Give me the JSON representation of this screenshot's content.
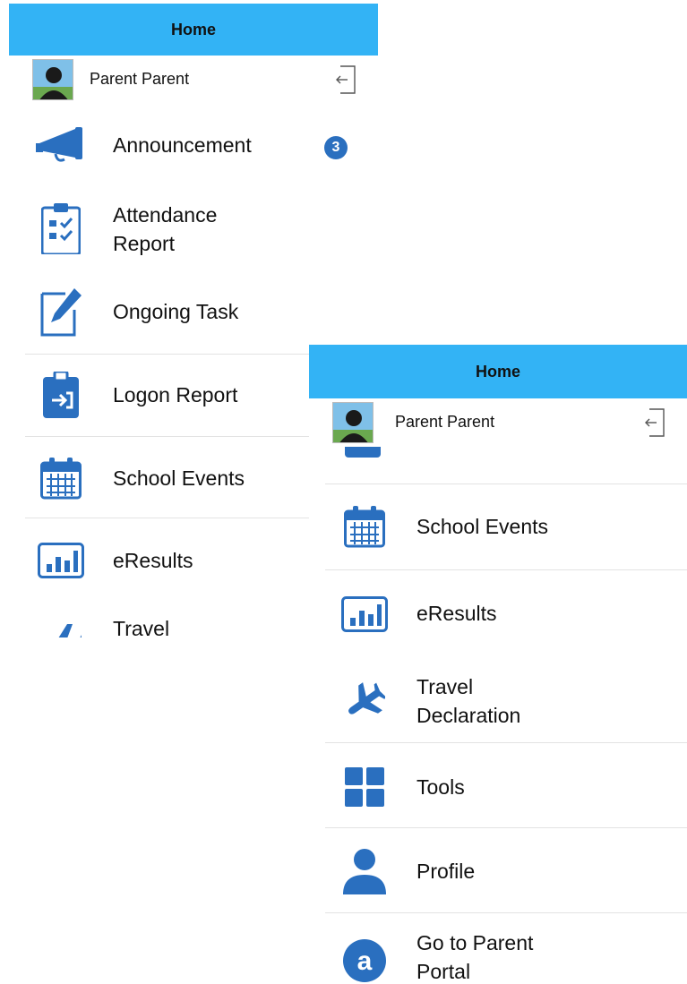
{
  "screen1": {
    "title": "Home",
    "user_name": "Parent  Parent",
    "menu": [
      {
        "label": "Announcement",
        "icon": "megaphone-icon",
        "badge": "3"
      },
      {
        "label": "Attendance Report",
        "icon": "clipboard-checklist-icon"
      },
      {
        "label": "Ongoing Task",
        "icon": "edit-document-icon"
      },
      {
        "label": "Logon Report",
        "icon": "clipboard-login-icon"
      },
      {
        "label": "School Events",
        "icon": "calendar-icon"
      },
      {
        "label": "eResults",
        "icon": "bar-chart-icon"
      },
      {
        "label": "Travel",
        "icon": "airplane-icon"
      }
    ]
  },
  "screen2": {
    "title": "Home",
    "user_name": "Parent  Parent",
    "menu": [
      {
        "label": "School Events",
        "icon": "calendar-icon"
      },
      {
        "label": "eResults",
        "icon": "bar-chart-icon"
      },
      {
        "label": "Travel Declaration",
        "icon": "airplane-icon"
      },
      {
        "label": "Tools",
        "icon": "grid-icon"
      },
      {
        "label": "Profile",
        "icon": "person-icon"
      },
      {
        "label": "Go to Parent Portal",
        "icon": "portal-a-icon"
      }
    ]
  },
  "colors": {
    "header": "#33b3f5",
    "icon": "#2a6fbf",
    "badge": "#2a6fbf"
  }
}
